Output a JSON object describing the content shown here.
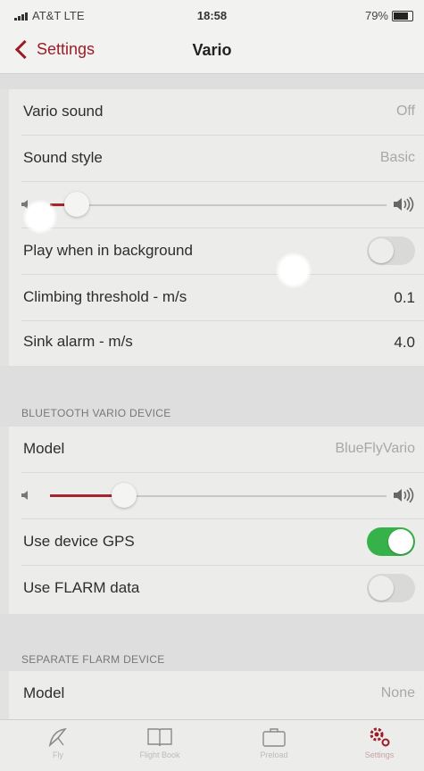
{
  "status": {
    "carrier": "AT&T  LTE",
    "time": "18:58",
    "battery": "79%"
  },
  "nav": {
    "back_label": "Settings",
    "title": "Vario"
  },
  "vario": {
    "sound_label": "Vario sound",
    "sound_value": "Off",
    "style_label": "Sound style",
    "style_value": "Basic",
    "volume_level": 0.08,
    "background_label": "Play when in background",
    "background_on": false,
    "climb_label": "Climbing threshold - m/s",
    "climb_value": "0.1",
    "sink_label": "Sink alarm - m/s",
    "sink_value": "4.0"
  },
  "bluetooth": {
    "header": "BLUETOOTH VARIO DEVICE",
    "model_label": "Model",
    "model_value": "BlueFlyVario",
    "volume_level": 0.22,
    "gps_label": "Use device GPS",
    "gps_on": true,
    "flarm_label": "Use FLARM data",
    "flarm_on": false
  },
  "flarm": {
    "header": "SEPARATE FLARM DEVICE",
    "model_label": "Model",
    "model_value": "None"
  },
  "tabs": [
    {
      "icon": "glider-icon",
      "label": "Fly"
    },
    {
      "icon": "book-icon",
      "label": "Flight Book"
    },
    {
      "icon": "briefcase-icon",
      "label": "Preload"
    },
    {
      "icon": "gear-icon",
      "label": "Settings"
    }
  ],
  "colors": {
    "accent": "#9c1d28",
    "toggle_on": "#37b24a"
  }
}
